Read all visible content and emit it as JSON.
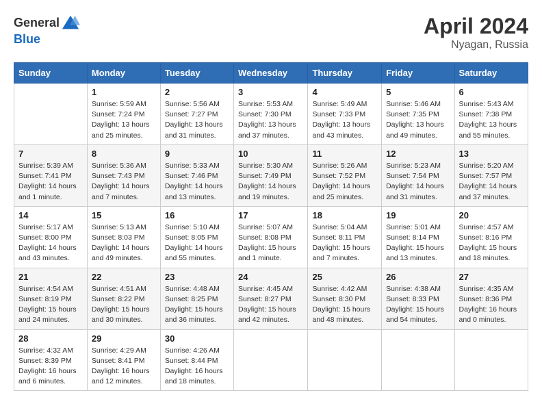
{
  "header": {
    "logo_general": "General",
    "logo_blue": "Blue",
    "month": "April 2024",
    "location": "Nyagan, Russia"
  },
  "weekdays": [
    "Sunday",
    "Monday",
    "Tuesday",
    "Wednesday",
    "Thursday",
    "Friday",
    "Saturday"
  ],
  "weeks": [
    [
      {
        "day": "",
        "info": ""
      },
      {
        "day": "1",
        "info": "Sunrise: 5:59 AM\nSunset: 7:24 PM\nDaylight: 13 hours\nand 25 minutes."
      },
      {
        "day": "2",
        "info": "Sunrise: 5:56 AM\nSunset: 7:27 PM\nDaylight: 13 hours\nand 31 minutes."
      },
      {
        "day": "3",
        "info": "Sunrise: 5:53 AM\nSunset: 7:30 PM\nDaylight: 13 hours\nand 37 minutes."
      },
      {
        "day": "4",
        "info": "Sunrise: 5:49 AM\nSunset: 7:33 PM\nDaylight: 13 hours\nand 43 minutes."
      },
      {
        "day": "5",
        "info": "Sunrise: 5:46 AM\nSunset: 7:35 PM\nDaylight: 13 hours\nand 49 minutes."
      },
      {
        "day": "6",
        "info": "Sunrise: 5:43 AM\nSunset: 7:38 PM\nDaylight: 13 hours\nand 55 minutes."
      }
    ],
    [
      {
        "day": "7",
        "info": "Sunrise: 5:39 AM\nSunset: 7:41 PM\nDaylight: 14 hours\nand 1 minute."
      },
      {
        "day": "8",
        "info": "Sunrise: 5:36 AM\nSunset: 7:43 PM\nDaylight: 14 hours\nand 7 minutes."
      },
      {
        "day": "9",
        "info": "Sunrise: 5:33 AM\nSunset: 7:46 PM\nDaylight: 14 hours\nand 13 minutes."
      },
      {
        "day": "10",
        "info": "Sunrise: 5:30 AM\nSunset: 7:49 PM\nDaylight: 14 hours\nand 19 minutes."
      },
      {
        "day": "11",
        "info": "Sunrise: 5:26 AM\nSunset: 7:52 PM\nDaylight: 14 hours\nand 25 minutes."
      },
      {
        "day": "12",
        "info": "Sunrise: 5:23 AM\nSunset: 7:54 PM\nDaylight: 14 hours\nand 31 minutes."
      },
      {
        "day": "13",
        "info": "Sunrise: 5:20 AM\nSunset: 7:57 PM\nDaylight: 14 hours\nand 37 minutes."
      }
    ],
    [
      {
        "day": "14",
        "info": "Sunrise: 5:17 AM\nSunset: 8:00 PM\nDaylight: 14 hours\nand 43 minutes."
      },
      {
        "day": "15",
        "info": "Sunrise: 5:13 AM\nSunset: 8:03 PM\nDaylight: 14 hours\nand 49 minutes."
      },
      {
        "day": "16",
        "info": "Sunrise: 5:10 AM\nSunset: 8:05 PM\nDaylight: 14 hours\nand 55 minutes."
      },
      {
        "day": "17",
        "info": "Sunrise: 5:07 AM\nSunset: 8:08 PM\nDaylight: 15 hours\nand 1 minute."
      },
      {
        "day": "18",
        "info": "Sunrise: 5:04 AM\nSunset: 8:11 PM\nDaylight: 15 hours\nand 7 minutes."
      },
      {
        "day": "19",
        "info": "Sunrise: 5:01 AM\nSunset: 8:14 PM\nDaylight: 15 hours\nand 13 minutes."
      },
      {
        "day": "20",
        "info": "Sunrise: 4:57 AM\nSunset: 8:16 PM\nDaylight: 15 hours\nand 18 minutes."
      }
    ],
    [
      {
        "day": "21",
        "info": "Sunrise: 4:54 AM\nSunset: 8:19 PM\nDaylight: 15 hours\nand 24 minutes."
      },
      {
        "day": "22",
        "info": "Sunrise: 4:51 AM\nSunset: 8:22 PM\nDaylight: 15 hours\nand 30 minutes."
      },
      {
        "day": "23",
        "info": "Sunrise: 4:48 AM\nSunset: 8:25 PM\nDaylight: 15 hours\nand 36 minutes."
      },
      {
        "day": "24",
        "info": "Sunrise: 4:45 AM\nSunset: 8:27 PM\nDaylight: 15 hours\nand 42 minutes."
      },
      {
        "day": "25",
        "info": "Sunrise: 4:42 AM\nSunset: 8:30 PM\nDaylight: 15 hours\nand 48 minutes."
      },
      {
        "day": "26",
        "info": "Sunrise: 4:38 AM\nSunset: 8:33 PM\nDaylight: 15 hours\nand 54 minutes."
      },
      {
        "day": "27",
        "info": "Sunrise: 4:35 AM\nSunset: 8:36 PM\nDaylight: 16 hours\nand 0 minutes."
      }
    ],
    [
      {
        "day": "28",
        "info": "Sunrise: 4:32 AM\nSunset: 8:39 PM\nDaylight: 16 hours\nand 6 minutes."
      },
      {
        "day": "29",
        "info": "Sunrise: 4:29 AM\nSunset: 8:41 PM\nDaylight: 16 hours\nand 12 minutes."
      },
      {
        "day": "30",
        "info": "Sunrise: 4:26 AM\nSunset: 8:44 PM\nDaylight: 16 hours\nand 18 minutes."
      },
      {
        "day": "",
        "info": ""
      },
      {
        "day": "",
        "info": ""
      },
      {
        "day": "",
        "info": ""
      },
      {
        "day": "",
        "info": ""
      }
    ]
  ]
}
